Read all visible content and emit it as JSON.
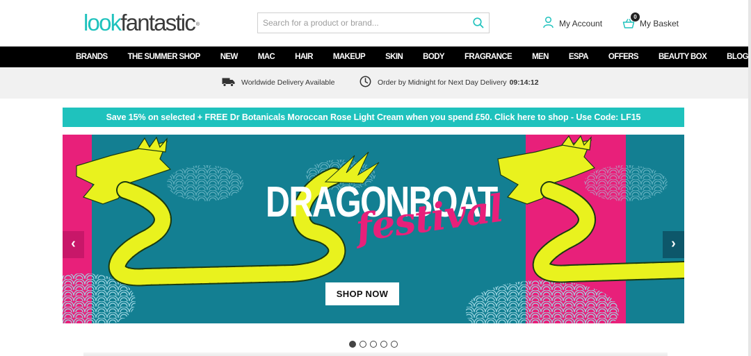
{
  "header": {
    "logo": {
      "part1": "look",
      "part2": "fantastic",
      "mark": "®"
    },
    "search": {
      "placeholder": "Search for a product or brand...",
      "value": ""
    },
    "account_label": "My Account",
    "basket_label": "My Basket",
    "basket_count": "0"
  },
  "nav": {
    "items": [
      "BRANDS",
      "THE SUMMER SHOP",
      "NEW",
      "MAC",
      "HAIR",
      "MAKEUP",
      "SKIN",
      "BODY",
      "FRAGRANCE",
      "MEN",
      "ESPA",
      "OFFERS",
      "BEAUTY BOX",
      "BLOG"
    ]
  },
  "usp": {
    "delivery": "Worldwide Delivery Available",
    "next_day": "Order by Midnight for Next Day Delivery",
    "countdown": "09:14:12"
  },
  "promo": {
    "text": "Save 15% on selected + FREE Dr Botanicals Moroccan Rose Light Cream when you spend £50. Click here to shop  - Use Code: LF15"
  },
  "hero": {
    "title": "DRAGONBOAT",
    "subtitle": "festival",
    "cta": "SHOP NOW",
    "prev": "‹",
    "next": "›",
    "slide_count": 5,
    "active_slide": 1
  },
  "colors": {
    "brand_teal": "#1fc2bd",
    "nav_bg": "#000000",
    "hero_bg": "#137f92",
    "hero_pink": "#e8207a",
    "dragon_yellow": "#e9f21e"
  },
  "icons": {
    "search": "search-icon",
    "account": "user-icon",
    "basket": "basket-icon",
    "delivery": "truck-icon",
    "clock": "clock-icon"
  }
}
